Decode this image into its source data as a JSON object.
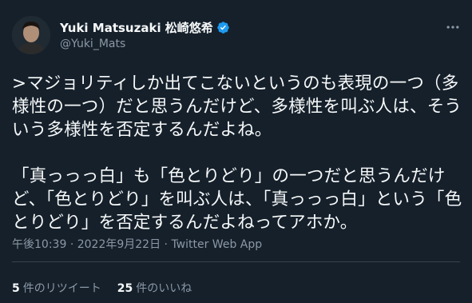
{
  "author": {
    "display_name": "Yuki Matsuzaki 松崎悠希",
    "handle": "@Yuki_Mats",
    "verified": true
  },
  "tweet": {
    "text": ">マジョリティしか出てこないというのも表現の一つ（多様性の一つ）だと思うんだけど、多様性を叫ぶ人は、そういう多様性を否定するんだよね。\n\n「真っっっ白」も「色とりどり」の一つだと思うんだけど、「色とりどり」を叫ぶ人は、「真っっっ白」という「色とりどり」を否定するんだよねってアホか。",
    "time": "午後10:39",
    "separator": "·",
    "date": "2022年9月22日",
    "client": "Twitter Web App"
  },
  "stats": {
    "retweets_count": "5",
    "retweets_label": "件のリツイート",
    "likes_count": "25",
    "likes_label": "件のいいね"
  },
  "colors": {
    "background": "#15202b",
    "text": "#f7f9f9",
    "secondary": "#8b98a5",
    "verified": "#1d9bf0",
    "divider": "#38444d"
  },
  "icons": {
    "verified": "verified-badge-icon",
    "more": "more-options-icon"
  }
}
